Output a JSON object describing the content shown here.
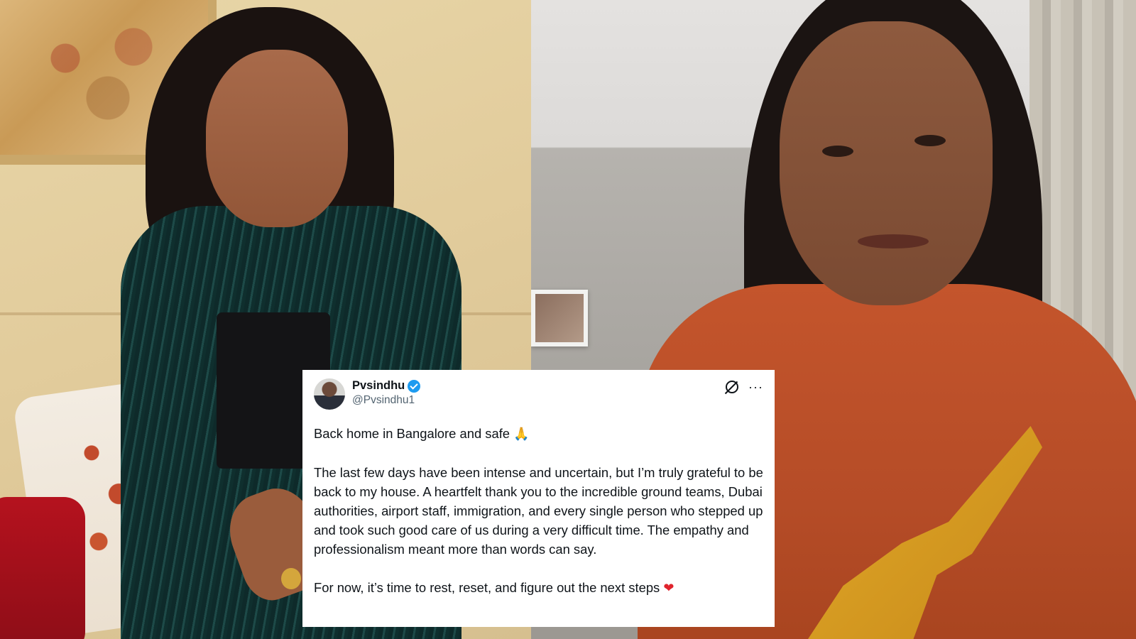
{
  "images": {
    "left_photo": "woman-in-green-sequin-jacket-seated",
    "right_photo": "woman-in-orange-sweatshirt-selfie-video"
  },
  "tweet": {
    "display_name": "Pvsindhu",
    "handle": "@Pvsindhu1",
    "verified": true,
    "icons": [
      "grok-icon",
      "more-icon"
    ],
    "paragraphs": [
      {
        "text": "Back home in Bangalore and safe",
        "emoji": "🙏"
      },
      {
        "text": "The last few days have been intense and uncertain, but I’m truly grateful to be back to my house. A heartfelt thank you to the incredible ground teams, Dubai authorities, airport staff, immigration, and every single person who stepped up and took such good care of us during a very difficult time. The empathy and professionalism meant more than words can say.",
        "emoji": ""
      },
      {
        "text": "For now, it’s time to rest, reset, and figure out the next steps",
        "emoji": "❤"
      }
    ],
    "colors": {
      "verified": "#1d9bf0",
      "heart": "#e0242d",
      "text": "#0f1419",
      "handle": "#536471"
    }
  }
}
